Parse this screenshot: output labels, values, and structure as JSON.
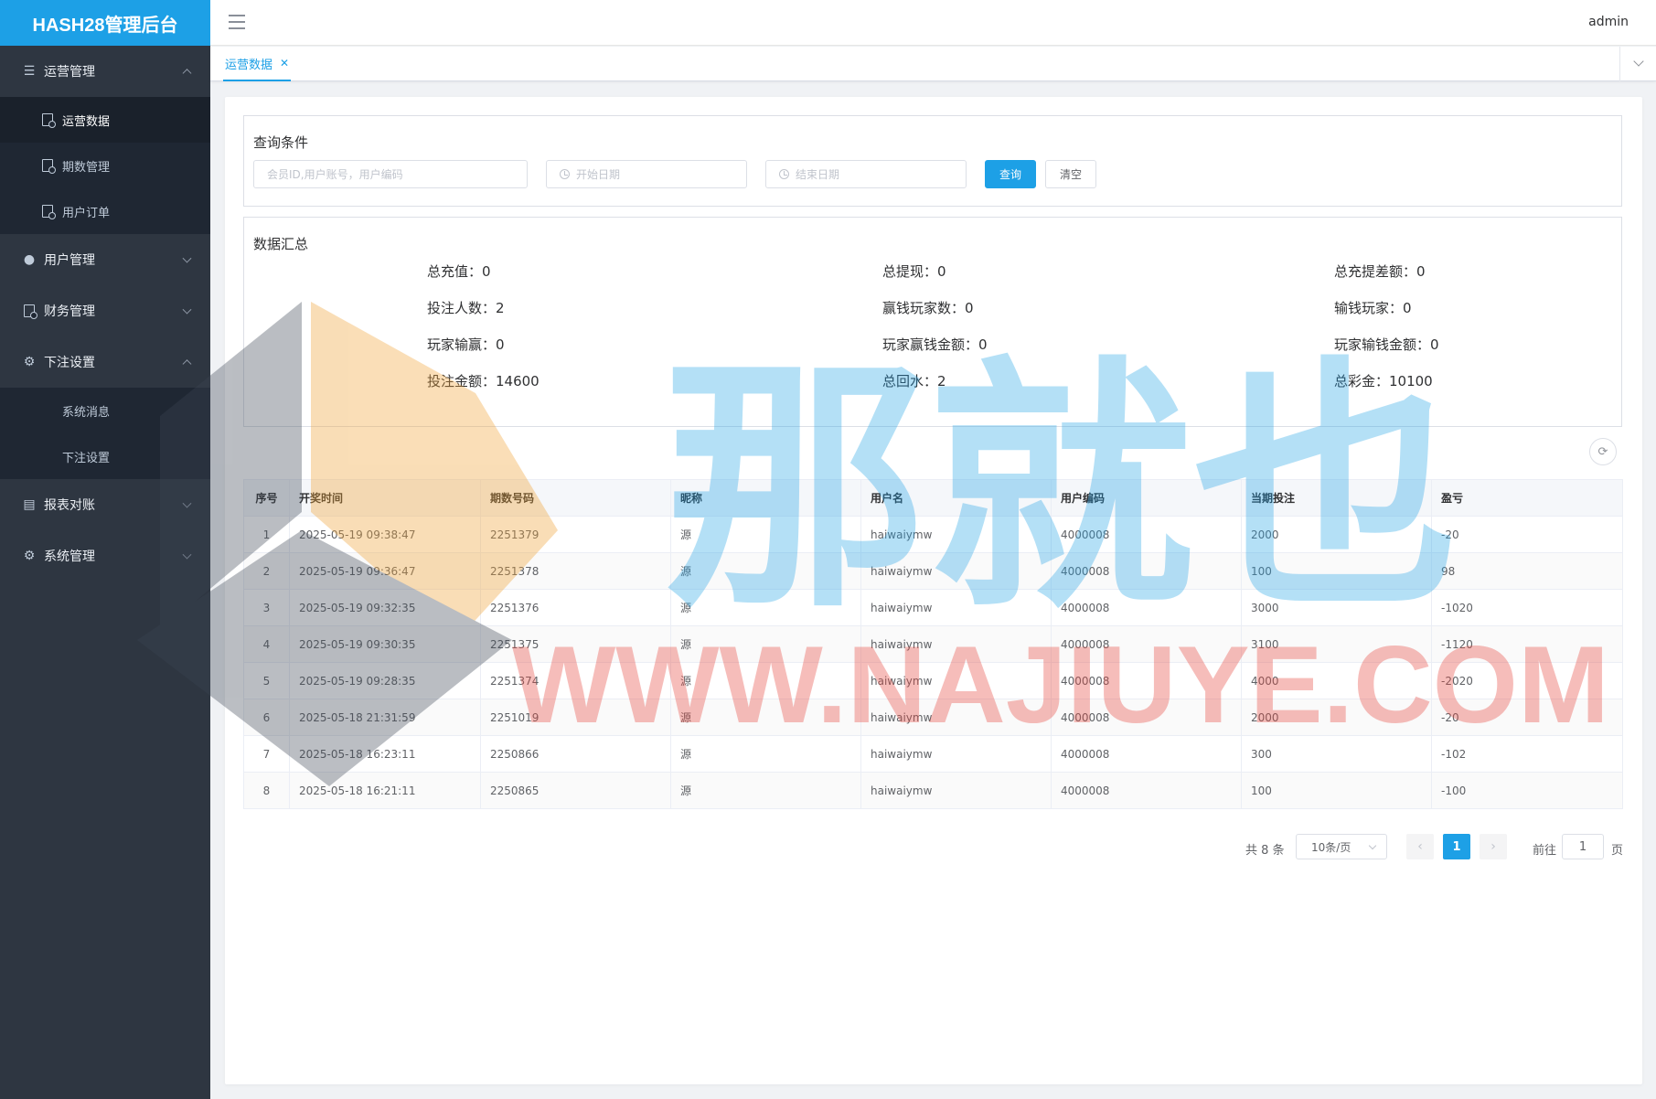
{
  "app": {
    "title": "HASH28管理后台",
    "user": "admin"
  },
  "sidebar": {
    "groups": [
      {
        "label": "运营管理",
        "expanded": true,
        "items": [
          {
            "label": "运营数据",
            "active": true
          },
          {
            "label": "期数管理"
          },
          {
            "label": "用户订单"
          }
        ]
      },
      {
        "label": "用户管理",
        "expanded": false
      },
      {
        "label": "财务管理",
        "expanded": false
      },
      {
        "label": "下注设置",
        "expanded": true,
        "items": [
          {
            "label": "系统消息"
          },
          {
            "label": "下注设置"
          }
        ]
      },
      {
        "label": "报表对账",
        "expanded": false
      },
      {
        "label": "系统管理",
        "expanded": false
      }
    ]
  },
  "tabs": [
    {
      "label": "运营数据",
      "active": true
    }
  ],
  "query": {
    "title": "查询条件",
    "search_placeholder": "会员ID,用户账号，用户编码",
    "start_placeholder": "开始日期",
    "end_placeholder": "结束日期",
    "search_button": "查询",
    "clear_button": "清空"
  },
  "summary": {
    "title": "数据汇总",
    "stats": [
      "总充值：0",
      "总提现：0",
      "总充提差额：0",
      "投注人数：2",
      "赢钱玩家数：0",
      "输钱玩家：0",
      "玩家输赢：0",
      "玩家赢钱金额：0",
      "玩家输钱金额：0",
      "投注金额：14600",
      "总回水：2",
      "总彩金：10100"
    ]
  },
  "table": {
    "columns": [
      "序号",
      "开奖时间",
      "期数号码",
      "昵称",
      "用户名",
      "用户编码",
      "当期投注",
      "盈亏"
    ],
    "rows": [
      [
        "1",
        "2025-05-19 09:38:47",
        "2251379",
        "源",
        "haiwaiymw",
        "4000008",
        "2000",
        "-20"
      ],
      [
        "2",
        "2025-05-19 09:36:47",
        "2251378",
        "源",
        "haiwaiymw",
        "4000008",
        "100",
        "98"
      ],
      [
        "3",
        "2025-05-19 09:32:35",
        "2251376",
        "源",
        "haiwaiymw",
        "4000008",
        "3000",
        "-1020"
      ],
      [
        "4",
        "2025-05-19 09:30:35",
        "2251375",
        "源",
        "haiwaiymw",
        "4000008",
        "3100",
        "-1120"
      ],
      [
        "5",
        "2025-05-19 09:28:35",
        "2251374",
        "源",
        "haiwaiymw",
        "4000008",
        "4000",
        "-2020"
      ],
      [
        "6",
        "2025-05-18 21:31:59",
        "2251019",
        "源",
        "haiwaiymw",
        "4000008",
        "2000",
        "-20"
      ],
      [
        "7",
        "2025-05-18 16:23:11",
        "2250866",
        "源",
        "haiwaiymw",
        "4000008",
        "300",
        "-102"
      ],
      [
        "8",
        "2025-05-18 16:21:11",
        "2250865",
        "源",
        "haiwaiymw",
        "4000008",
        "100",
        "-100"
      ]
    ]
  },
  "pagination": {
    "total": "共 8 条",
    "page_size": "10条/页",
    "current_page": "1",
    "goto_label": "前往",
    "goto_value": "1",
    "page_suffix": "页",
    "prev_icon": "chevron-left-icon",
    "next_icon": "chevron-right-icon"
  },
  "watermark": {
    "text_cn": "那就也",
    "text_en": "WWW.NAJIUYE.COM"
  },
  "colors": {
    "accent": "#1da0e6",
    "sidebar": "#2e3641",
    "submenu": "#1f2733",
    "loss": "#13a10e",
    "gain": "#c0392b"
  }
}
